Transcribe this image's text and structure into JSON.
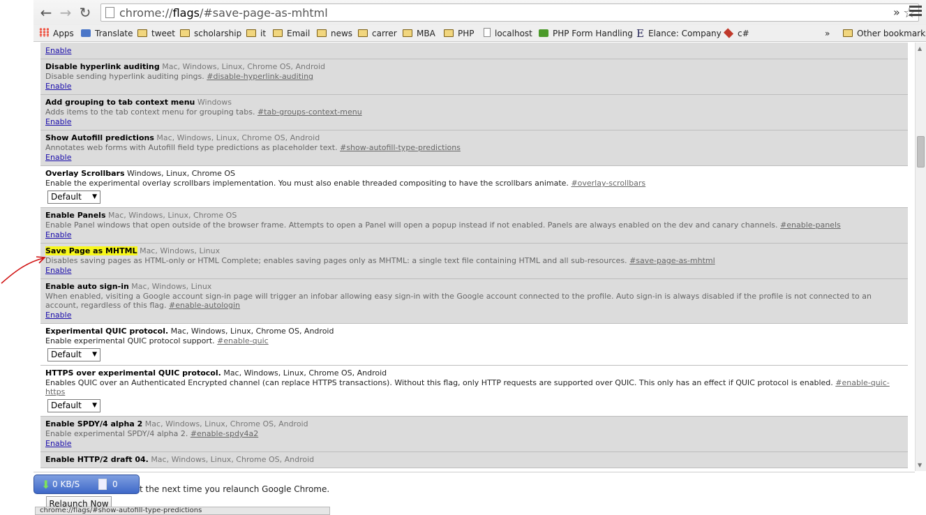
{
  "toolbar": {
    "back_icon": "back-arrow-icon",
    "forward_icon": "forward-arrow-icon",
    "reload_icon": "reload-icon",
    "url_scheme": "chrome://",
    "url_host": "flags",
    "url_rest": "/#save-page-as-mhtml",
    "star_icon": "star-icon",
    "overflow_label": "»",
    "menu_icon": "menu-icon"
  },
  "bookmarks": {
    "items": [
      {
        "label": "Apps",
        "icon": "apps-icon"
      },
      {
        "label": "Translate",
        "icon": "translate-icon"
      },
      {
        "label": "tweet",
        "icon": "folder-icon"
      },
      {
        "label": "scholarship",
        "icon": "folder-icon"
      },
      {
        "label": "it",
        "icon": "folder-icon"
      },
      {
        "label": "Email",
        "icon": "folder-icon"
      },
      {
        "label": "news",
        "icon": "folder-icon"
      },
      {
        "label": "carrer",
        "icon": "folder-icon"
      },
      {
        "label": "MBA",
        "icon": "folder-icon"
      },
      {
        "label": "PHP",
        "icon": "folder-icon"
      },
      {
        "label": "localhost",
        "icon": "page-icon"
      },
      {
        "label": "PHP Form Handling",
        "icon": "green-site-icon"
      },
      {
        "label": "Elance: Company",
        "icon": "elance-icon"
      },
      {
        "label": "c#",
        "icon": "red-site-icon"
      }
    ],
    "overflow_label": "»",
    "other_label": "Other bookmarks"
  },
  "flags": [
    {
      "name": "",
      "platforms": "",
      "description": "",
      "anchor": "",
      "action": "link",
      "action_label": "Enable",
      "supported": false
    },
    {
      "name": "Disable hyperlink auditing",
      "platforms": "Mac, Windows, Linux, Chrome OS, Android",
      "description": "Disable sending hyperlink auditing pings.",
      "anchor": "#disable-hyperlink-auditing",
      "action": "link",
      "action_label": "Enable",
      "supported": false
    },
    {
      "name": "Add grouping to tab context menu",
      "platforms": "Windows",
      "description": "Adds items to the tab context menu for grouping tabs.",
      "anchor": "#tab-groups-context-menu",
      "action": "link",
      "action_label": "Enable",
      "supported": false
    },
    {
      "name": "Show Autofill predictions",
      "platforms": "Mac, Windows, Linux, Chrome OS, Android",
      "description": "Annotates web forms with Autofill field type predictions as placeholder text.",
      "anchor": "#show-autofill-type-predictions",
      "action": "link",
      "action_label": "Enable",
      "supported": false
    },
    {
      "name": "Overlay Scrollbars",
      "platforms": "Windows, Linux, Chrome OS",
      "description": "Enable the experimental overlay scrollbars implementation. You must also enable threaded compositing to have the scrollbars animate.",
      "anchor": "#overlay-scrollbars",
      "action": "select",
      "action_label": "Default",
      "supported": true
    },
    {
      "name": "Enable Panels",
      "platforms": "Mac, Windows, Linux, Chrome OS",
      "description": "Enable Panel windows that open outside of the browser frame. Attempts to open a Panel will open a popup instead if not enabled. Panels are always enabled on the dev and canary channels.",
      "anchor": "#enable-panels",
      "action": "link",
      "action_label": "Enable",
      "supported": false
    },
    {
      "name": "Save Page as MHTML",
      "platforms": "Mac, Windows, Linux",
      "description": "Disables saving pages as HTML-only or HTML Complete; enables saving pages only as MHTML: a single text file containing HTML and all sub-resources.",
      "anchor": "#save-page-as-mhtml",
      "action": "link",
      "action_label": "Enable",
      "supported": false,
      "highlighted": true
    },
    {
      "name": "Enable auto sign-in",
      "platforms": "Mac, Windows, Linux",
      "description": "When enabled, visiting a Google account sign-in page will trigger an infobar allowing easy sign-in with the Google account connected to the profile. Auto sign-in is always disabled if the profile is not connected to an account, regardless of this flag.",
      "anchor": "#enable-autologin",
      "action": "link",
      "action_label": "Enable",
      "supported": false
    },
    {
      "name": "Experimental QUIC protocol.",
      "platforms": "Mac, Windows, Linux, Chrome OS, Android",
      "description": "Enable experimental QUIC protocol support.",
      "anchor": "#enable-quic",
      "action": "select",
      "action_label": "Default",
      "supported": true
    },
    {
      "name": "HTTPS over experimental QUIC protocol.",
      "platforms": "Mac, Windows, Linux, Chrome OS, Android",
      "description": "Enables QUIC over an Authenticated Encrypted channel (can replace HTTPS transactions). Without this flag, only HTTP requests are supported over QUIC. This only has an effect if QUIC protocol is enabled.",
      "anchor": "#enable-quic-https",
      "action": "select",
      "action_label": "Default",
      "supported": true
    },
    {
      "name": "Enable SPDY/4 alpha 2",
      "platforms": "Mac, Windows, Linux, Chrome OS, Android",
      "description": "Enable experimental SPDY/4 alpha 2.",
      "anchor": "#enable-spdy4a2",
      "action": "link",
      "action_label": "Enable",
      "supported": false
    },
    {
      "name": "Enable HTTP/2 draft 04.",
      "platforms": "Mac, Windows, Linux, Chrome OS, Android",
      "description": "",
      "anchor": "",
      "action": "none",
      "action_label": "",
      "supported": false
    }
  ],
  "relaunch": {
    "message": "ect the next time you relaunch Google Chrome.",
    "button_label": "Relaunch Now"
  },
  "speed_widget": {
    "speed": "0 KB/S",
    "count": "0"
  },
  "status_bubble": "chrome://flags/#show-autofill-type-predictions",
  "colors": {
    "highlight": "#f7f71a",
    "link": "#1a0dab",
    "unsupported_bg": "#dcdcdc",
    "annotation": "#d01010",
    "widget_blue": "#3e68c8"
  }
}
